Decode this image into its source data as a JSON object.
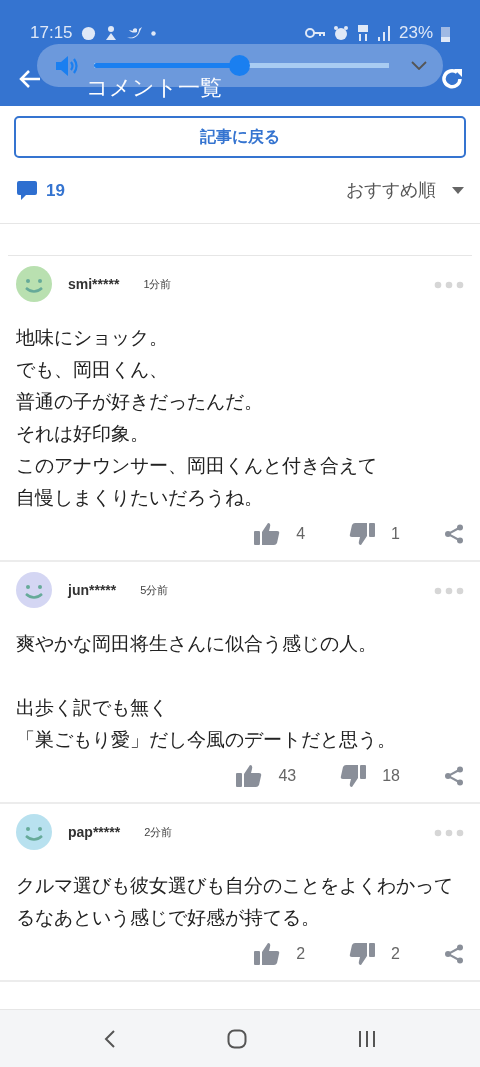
{
  "status_bar": {
    "time": "17:15",
    "battery": "23%"
  },
  "header": {
    "title": "コメント一覧"
  },
  "volume_overlay": {
    "level": 0.49
  },
  "back_button": {
    "label": "記事に戻る"
  },
  "comment_count": "19",
  "sort": {
    "label": "おすすめ順"
  },
  "comments": [
    {
      "user": "smi*****",
      "time": "1分前",
      "color": "#b9e0b0",
      "paragraphs": [
        [
          "地味にショック。",
          "でも、岡田くん、",
          "普通の子が好きだったんだ。",
          "それは好印象。",
          "このアナウンサー、岡田くんと付き合えて",
          "自慢しまくりたいだろうね。"
        ]
      ],
      "likes": "4",
      "dislikes": "1"
    },
    {
      "user": "jun*****",
      "time": "5分前",
      "color": "#d4d6f3",
      "paragraphs": [
        [
          "爽やかな岡田将生さんに似合う感じの人。"
        ],
        [
          "出歩く訳でも無く",
          "「巣ごもり愛」だし今風のデートだと思う。"
        ]
      ],
      "likes": "43",
      "dislikes": "18"
    },
    {
      "user": "pap*****",
      "time": "2分前",
      "color": "#b8e1ef",
      "paragraphs": [
        [
          "クルマ選びも彼女選びも自分のことをよくわかってるなあという感じで好感が持てる。"
        ]
      ],
      "likes": "2",
      "dislikes": "2"
    }
  ]
}
